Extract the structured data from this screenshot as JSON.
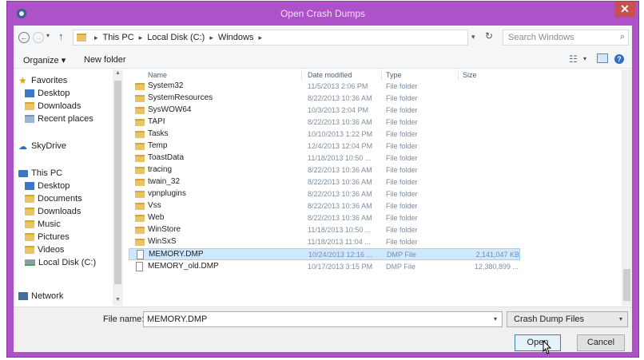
{
  "window": {
    "title": "Open Crash Dumps",
    "close_glyph": "✕",
    "accent": "#ad52c8"
  },
  "address": {
    "crumbs": [
      "This PC",
      "Local Disk (C:)",
      "Windows"
    ],
    "search_placeholder": "Search Windows"
  },
  "toolbar": {
    "organize_label": "Organize ▾",
    "new_folder_label": "New folder"
  },
  "nav": {
    "favorites": "Favorites",
    "desktop": "Desktop",
    "downloads": "Downloads",
    "recent": "Recent places",
    "skydrive": "SkyDrive",
    "this_pc": "This PC",
    "pc_desktop": "Desktop",
    "documents": "Documents",
    "pc_downloads": "Downloads",
    "music": "Music",
    "pictures": "Pictures",
    "videos": "Videos",
    "local_disk": "Local Disk (C:)",
    "network": "Network"
  },
  "columns": {
    "name": "Name",
    "date": "Date modified",
    "type": "Type",
    "size": "Size"
  },
  "files": [
    {
      "name": "System32",
      "date": "11/5/2013 2:06 PM",
      "type": "File folder",
      "size": ""
    },
    {
      "name": "SystemResources",
      "date": "8/22/2013 10:36 AM",
      "type": "File folder",
      "size": ""
    },
    {
      "name": "SysWOW64",
      "date": "10/3/2013 2:04 PM",
      "type": "File folder",
      "size": ""
    },
    {
      "name": "TAPI",
      "date": "8/22/2013 10:36 AM",
      "type": "File folder",
      "size": ""
    },
    {
      "name": "Tasks",
      "date": "10/10/2013 1:22 PM",
      "type": "File folder",
      "size": ""
    },
    {
      "name": "Temp",
      "date": "12/4/2013 12:04 PM",
      "type": "File folder",
      "size": ""
    },
    {
      "name": "ToastData",
      "date": "11/18/2013 10:50 ...",
      "type": "File folder",
      "size": ""
    },
    {
      "name": "tracing",
      "date": "8/22/2013 10:36 AM",
      "type": "File folder",
      "size": ""
    },
    {
      "name": "twain_32",
      "date": "8/22/2013 10:36 AM",
      "type": "File folder",
      "size": ""
    },
    {
      "name": "vpnplugins",
      "date": "8/22/2013 10:36 AM",
      "type": "File folder",
      "size": ""
    },
    {
      "name": "Vss",
      "date": "8/22/2013 10:36 AM",
      "type": "File folder",
      "size": ""
    },
    {
      "name": "Web",
      "date": "8/22/2013 10:36 AM",
      "type": "File folder",
      "size": ""
    },
    {
      "name": "WinStore",
      "date": "11/18/2013 10:50 ...",
      "type": "File folder",
      "size": ""
    },
    {
      "name": "WinSxS",
      "date": "11/18/2013 11:04 ...",
      "type": "File folder",
      "size": ""
    },
    {
      "name": "MEMORY.DMP",
      "date": "10/24/2013 12:16 ...",
      "type": "DMP File",
      "size": "2,141,047 KB"
    },
    {
      "name": "MEMORY_old.DMP",
      "date": "10/17/2013 3:15 PM",
      "type": "DMP File",
      "size": "12,380,899 ..."
    }
  ],
  "bottom": {
    "file_name_label": "File name:",
    "file_name_value": "MEMORY.DMP",
    "filter_value": "Crash Dump Files",
    "open_label": "Open",
    "cancel_label": "Cancel"
  }
}
